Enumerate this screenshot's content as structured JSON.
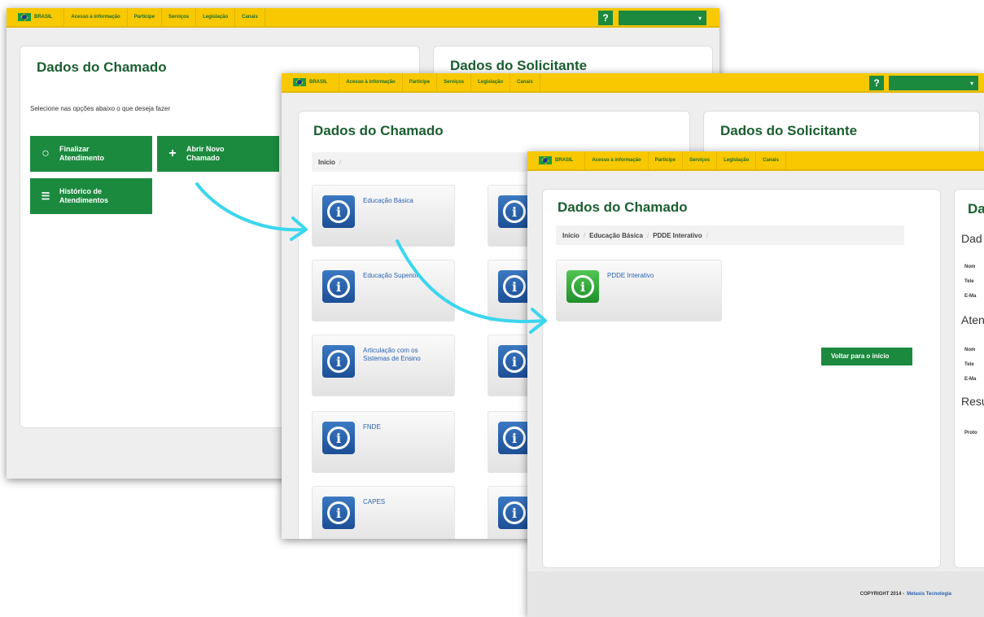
{
  "govbar": {
    "brasil": "BRASIL",
    "links": [
      "Acesso à informação",
      "Participe",
      "Serviços",
      "Legislação",
      "Canais"
    ],
    "help": "?"
  },
  "screen1": {
    "title_chamado": "Dados do Chamado",
    "title_solicitante": "Dados do Solicitante",
    "instruction": "Selecione nas opções abaixo o que deseja fazer",
    "btn_finalizar": "Finalizar Atendimento",
    "btn_abrir": "Abrir Novo Chamado",
    "btn_historico": "Histórico de Atendimentos"
  },
  "screen2": {
    "title_chamado": "Dados do Chamado",
    "title_solicitante": "Dados do Solicitante",
    "breadcrumb": [
      "Início"
    ],
    "cards": [
      "Educação Básica",
      "Educação Superior",
      "Articulação com os Sistemas de Ensino",
      "FNDE",
      "CAPES"
    ]
  },
  "screen3": {
    "title_chamado": "Dados do Chamado",
    "title_solicitante_partial": "Da",
    "breadcrumb": [
      "Início",
      "Educação Básica",
      "PDDE Interativo"
    ],
    "card": "PDDE Interativo",
    "btn_voltar": "Voltar para o início",
    "right_labels": [
      "Dad",
      "Nom",
      "Tele",
      "E-Ma",
      "Aten",
      "Nom",
      "Tele",
      "E-Ma",
      "Resu",
      "Proto"
    ],
    "copyright": "COPYRIGHT 2014 -",
    "copyright_link": "Metasis Tecnologia"
  },
  "colors": {
    "gov_yellow": "#f8c900",
    "gov_green": "#1b8a3f",
    "title_green": "#1b5e30",
    "arrow_cyan": "#3ad6ee"
  }
}
